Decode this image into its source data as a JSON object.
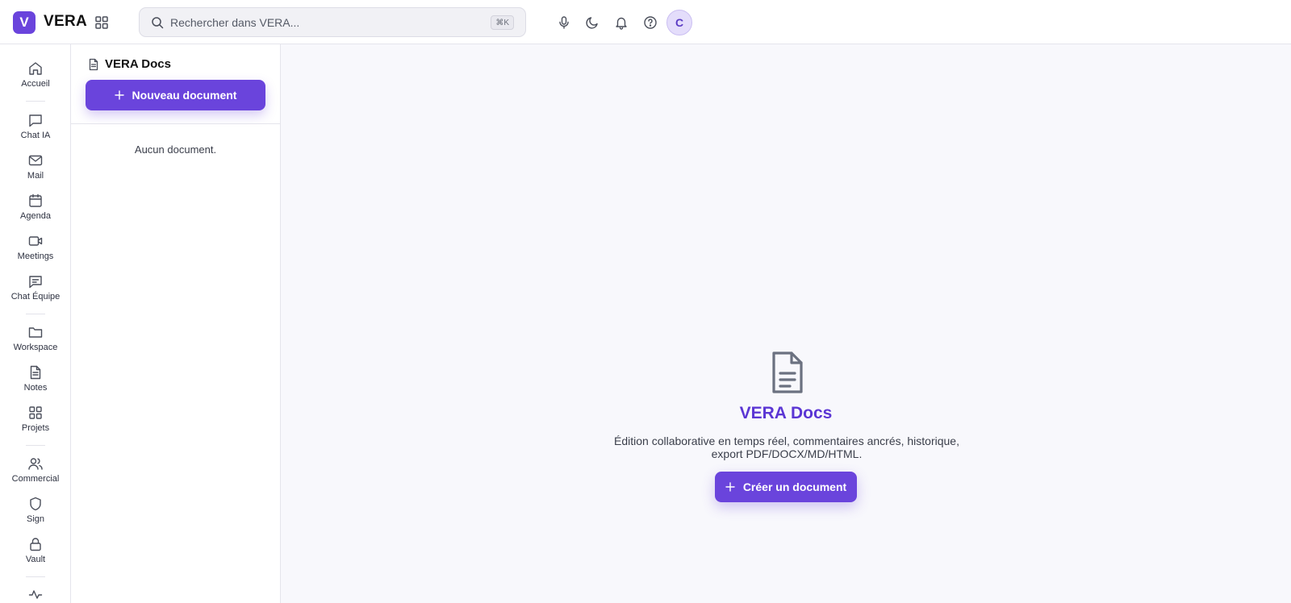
{
  "app": {
    "logo_letter": "V",
    "name": "VERA",
    "accent_color": "#6a44dc"
  },
  "search": {
    "placeholder": "Rechercher dans VERA...",
    "value": "",
    "shortcut": "⌘K"
  },
  "toolbar": {
    "icons": [
      "apps-grid-icon",
      "microphone-icon",
      "moon-icon",
      "bell-icon",
      "help-icon"
    ],
    "avatar_initial": "C"
  },
  "rail": {
    "items": [
      {
        "label": "Accueil",
        "icon": "home-icon"
      },
      {
        "label": "Chat IA",
        "icon": "chat-icon"
      },
      {
        "label": "Mail",
        "icon": "mail-icon"
      },
      {
        "label": "Agenda",
        "icon": "calendar-icon"
      },
      {
        "label": "Meetings",
        "icon": "video-icon"
      },
      {
        "label": "Chat Équipe",
        "icon": "team-chat-icon"
      },
      {
        "label": "Workspace",
        "icon": "folder-icon"
      },
      {
        "label": "Notes",
        "icon": "note-icon"
      },
      {
        "label": "Projets",
        "icon": "grid-icon"
      },
      {
        "label": "Commercial",
        "icon": "users-icon"
      },
      {
        "label": "Sign",
        "icon": "shield-icon"
      },
      {
        "label": "Vault",
        "icon": "lock-icon"
      }
    ]
  },
  "panel": {
    "title": "VERA Docs",
    "new_button": "Nouveau document",
    "empty_text": "Aucun document."
  },
  "main": {
    "title": "VERA Docs",
    "description_line1": "Édition collaborative en temps réel, commentaires ancrés, historique,",
    "description_line2": "export PDF/DOCX/MD/HTML.",
    "create_button": "Créer un document"
  }
}
